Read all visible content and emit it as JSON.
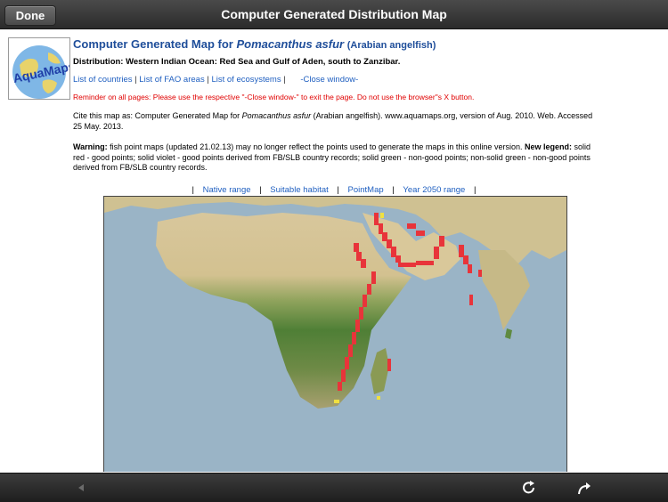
{
  "topbar": {
    "done_label": "Done",
    "title": "Computer Generated Distribution Map"
  },
  "logo": {
    "text": "AquaMaps"
  },
  "header": {
    "title_prefix": "Computer Generated Map for ",
    "species": "Pomacanthus asfur",
    "common_name": "(Arabian angelfish)",
    "distribution": "Distribution: Western Indian Ocean: Red Sea and Gulf of Aden, south to Zanzibar."
  },
  "links": {
    "countries": "List of countries",
    "fao_areas": "List of FAO areas",
    "ecosystems": "List of ecosystems",
    "close_window": "-Close window-"
  },
  "reminder": "Reminder on all pages: Please use the respective \"-Close window-\" to exit the page. Do not use the browser\"s X button.",
  "cite": {
    "prefix": "Cite this map as: Computer Generated Map for ",
    "species": "Pomacanthus asfur",
    "suffix": " (Arabian angelfish). www.aquamaps.org, version of Aug. 2010. Web. Accessed 25 May. 2013."
  },
  "warning": {
    "label": "Warning:",
    "text1": " fish point maps (updated 21.02.13) may no longer reflect the points used to generate the maps in this online version. ",
    "legend_label": "New legend:",
    "text2": " solid red - good points; solid violet - good points derived from FB/SLB country records; solid green - non-good points; non-solid green - non-good points derived from FB/SLB country records."
  },
  "tabs": {
    "native_range": "Native range",
    "suitable_habitat": "Suitable habitat",
    "point_map": "PointMap",
    "year_2050": "Year 2050 range"
  },
  "colors": {
    "toolbar": "#2b2b2b",
    "link": "#1f5fc0",
    "title": "#1f4e9a",
    "reminder": "#e00000",
    "ocean": "#9ab4c6",
    "desert": "#d8c79c",
    "forest": "#4f7f36",
    "range_red": "#e8343a",
    "range_yellow": "#f0e040"
  },
  "bottombar": {
    "back_icon": "back-arrow-icon",
    "reload_icon": "reload-icon",
    "share_icon": "share-icon"
  }
}
